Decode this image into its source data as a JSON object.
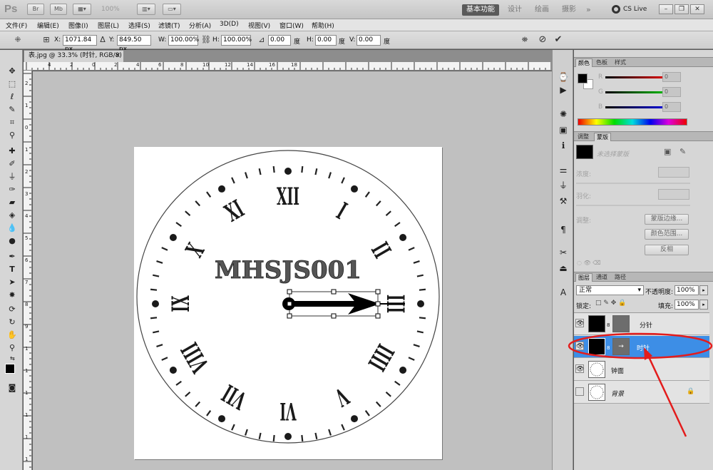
{
  "app": {
    "logo": "Ps",
    "zoom": "100%",
    "workspaces": [
      "基本功能",
      "设计",
      "绘画",
      "摄影"
    ],
    "more": "»",
    "cs_live": "CS Live"
  },
  "menu": [
    "文件(F)",
    "编辑(E)",
    "图像(I)",
    "图层(L)",
    "选择(S)",
    "滤镜(T)",
    "分析(A)",
    "3D(D)",
    "视图(V)",
    "窗口(W)",
    "帮助(H)"
  ],
  "options": {
    "x_label": "X:",
    "x_value": "1071.84 px",
    "y_label": "Y:",
    "y_value": "849.50 px",
    "w_label": "W:",
    "w_value": "100.00%",
    "h_label": "H:",
    "h_value": "100.00%",
    "angle_value": "0.00",
    "angle_unit": "度",
    "hskew_label": "H:",
    "hskew_value": "0.00",
    "hskew_unit": "度",
    "vskew_label": "V:",
    "vskew_value": "0.00",
    "vskew_unit": "度"
  },
  "document": {
    "tab_title": "表.jpg @ 33.3% (时针, RGB/8) *",
    "close": "×",
    "clock_text": "MHSJS001",
    "ruler_top": [
      "4",
      "2",
      "0",
      "2",
      "4",
      "6",
      "8",
      "10",
      "12",
      "14",
      "16",
      "18"
    ],
    "ruler_left": [
      "2",
      "1",
      "0",
      "1",
      "2",
      "3",
      "4",
      "5",
      "6",
      "7",
      "8",
      "9",
      "1",
      "1",
      "1",
      "1",
      "1",
      "1",
      "1"
    ]
  },
  "color_panel": {
    "tabs": [
      "颜色",
      "色板",
      "样式"
    ],
    "channels": [
      {
        "label": "R",
        "value": "0",
        "color": "#d40000"
      },
      {
        "label": "G",
        "value": "0",
        "color": "#00a000"
      },
      {
        "label": "B",
        "value": "0",
        "color": "#0000c8"
      }
    ]
  },
  "adjust_panel": {
    "tabs": [
      "调整",
      "蒙版"
    ],
    "mask_label": "未选择蒙版",
    "density": "浓度:",
    "feather": "羽化:",
    "refine": "调整:",
    "btn_mask_edge": "蒙版边缘...",
    "btn_color_range": "颜色范围...",
    "btn_invert": "反相"
  },
  "layers_panel": {
    "tabs": [
      "图层",
      "通道",
      "路径"
    ],
    "blend_mode": "正常",
    "opacity_label": "不透明度:",
    "opacity_value": "100%",
    "lock_label": "锁定:",
    "fill_label": "填充:",
    "fill_value": "100%",
    "layers": [
      {
        "name": "分针",
        "selected": false
      },
      {
        "name": "时针",
        "selected": true
      },
      {
        "name": "钟面",
        "selected": false
      },
      {
        "name": "背景",
        "selected": false
      }
    ]
  },
  "colors": {
    "selection": "#3d8ee6",
    "annotation": "#e31c1c"
  }
}
